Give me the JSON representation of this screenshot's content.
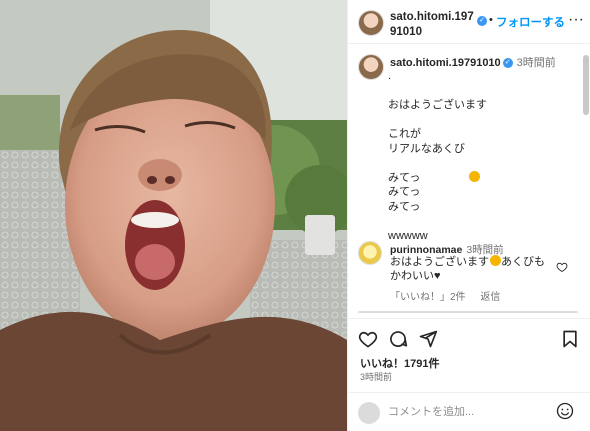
{
  "header": {
    "username": "sato.hitomi.19791010",
    "follow_label": "フォローする",
    "separator": "•",
    "more_icon": "more-horizontal-icon",
    "verified_icon": "verified-badge-icon"
  },
  "caption": {
    "username": "sato.hitomi.19791010",
    "time": "3時間前",
    "text": ".\n\nおはようございます\n\nこれが\nリアルなあくび\n\nみてっ\nみてっ\nみてっ\n\nwwwww"
  },
  "comment": {
    "username": "purinnonamae",
    "time": "3時間前",
    "text_part1": "おはようございます",
    "text_part2": "あくびもかわいい♥",
    "likes": "「いいね！」2件",
    "reply": "返信"
  },
  "actions": {
    "icons": [
      "heart-icon",
      "comment-icon",
      "share-icon",
      "bookmark-icon"
    ],
    "likes": "いいね！1791件",
    "time": "3時間前"
  },
  "composer": {
    "placeholder": "コメントを追加...",
    "emoji_icon": "smile-icon"
  },
  "colors": {
    "accent": "#0095f6",
    "verified": "#3897f0",
    "text": "#262626",
    "muted": "#737373"
  }
}
